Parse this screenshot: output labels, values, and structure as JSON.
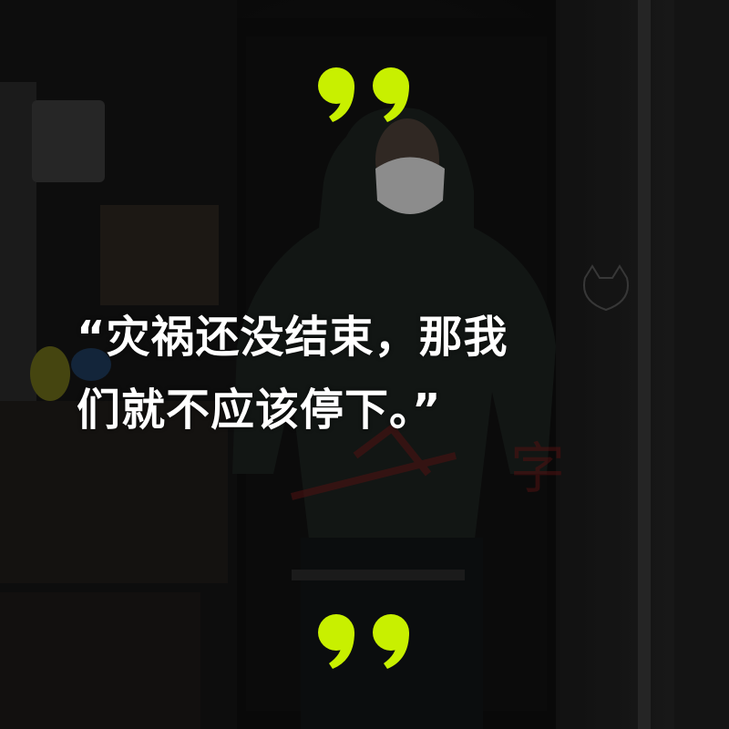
{
  "quote": {
    "line1": "“灾祸还没结束，那我",
    "line2": "们就不应该停下。”"
  },
  "background_sign": {
    "text": "字"
  },
  "colors": {
    "accent_quote_marks": "#c8f000",
    "text": "#ffffff",
    "sign_red": "#7a1a1a"
  },
  "icons": {
    "top": "open-quote-icon",
    "bottom": "close-quote-icon"
  }
}
